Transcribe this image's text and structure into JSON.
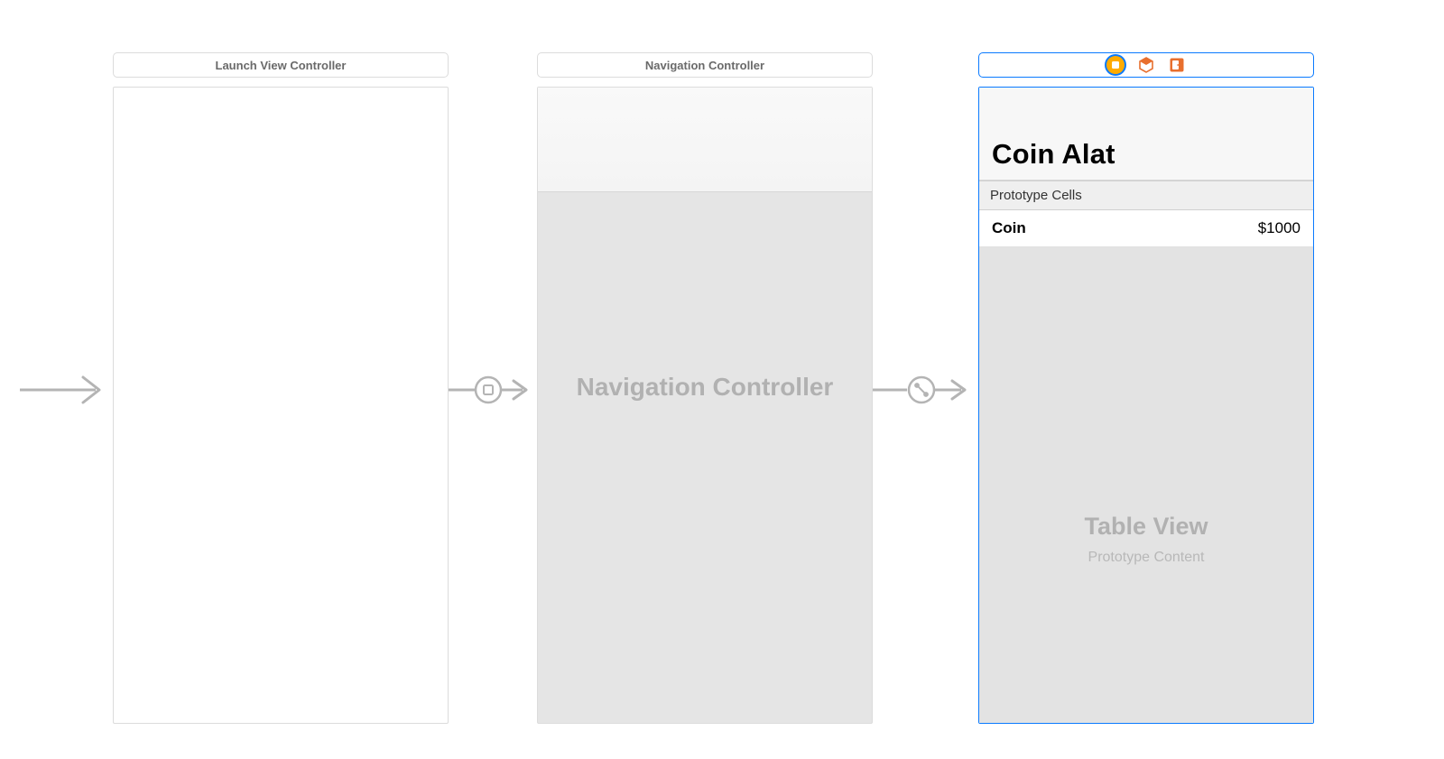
{
  "scene1": {
    "title": "Launch View Controller"
  },
  "scene2": {
    "title": "Navigation Controller",
    "placeholder": "Navigation Controller"
  },
  "scene3": {
    "navTitle": "Coin Alat",
    "prototypeLabel": "Prototype Cells",
    "cell": {
      "title": "Coin",
      "detail": "$1000"
    },
    "tableView": {
      "title": "Table View",
      "subtitle": "Prototype Content"
    }
  },
  "icons": {
    "firstResponder": "first-responder-icon",
    "exit": "exit-icon",
    "viewController": "view-controller-icon"
  }
}
